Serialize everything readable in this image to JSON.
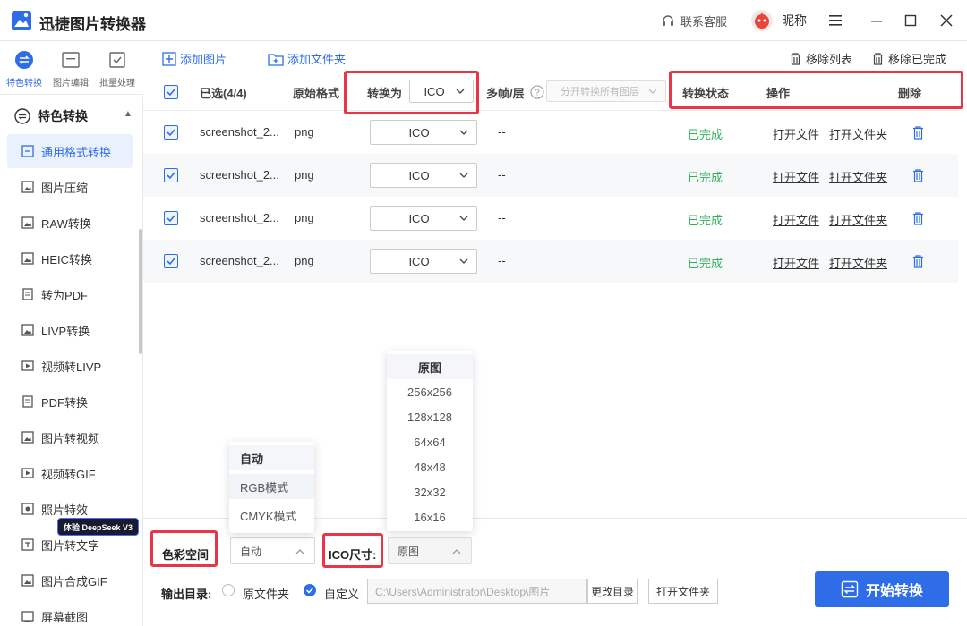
{
  "app": {
    "title": "迅捷图片转换器",
    "support_label": "联系客服",
    "nickname": "昵称"
  },
  "top_tabs": [
    {
      "label": "特色转换",
      "icon": "feature-convert-icon",
      "active": true
    },
    {
      "label": "图片编辑",
      "icon": "image-edit-icon",
      "active": false
    },
    {
      "label": "批量处理",
      "icon": "batch-process-icon",
      "active": false
    }
  ],
  "sidebar": {
    "section_title": "特色转换",
    "items": [
      {
        "label": "通用格式转换",
        "active": true
      },
      {
        "label": "图片压缩"
      },
      {
        "label": "RAW转换"
      },
      {
        "label": "HEIC转换"
      },
      {
        "label": "转为PDF"
      },
      {
        "label": "LIVP转换"
      },
      {
        "label": "视频转LIVP"
      },
      {
        "label": "PDF转换"
      },
      {
        "label": "图片转视频"
      },
      {
        "label": "视频转GIF"
      },
      {
        "label": "照片特效"
      },
      {
        "label": "图片转文字"
      },
      {
        "label": "图片合成GIF"
      },
      {
        "label": "屏幕截图"
      }
    ],
    "badge": "体验 DeepSeek V3"
  },
  "toolbar": {
    "add_image": "添加图片",
    "add_folder": "添加文件夹",
    "remove_list": "移除列表",
    "remove_done": "移除已完成"
  },
  "table": {
    "headers": {
      "selected": "已选(4/4)",
      "orig_format": "原始格式",
      "convert_to": "转换为",
      "convert_to_value": "ICO",
      "multi_frame": "多帧/层",
      "multi_frame_option": "分开转换所有图层",
      "status": "转换状态",
      "action": "操作",
      "delete": "删除"
    },
    "rows": [
      {
        "name": "screenshot_2...",
        "format": "png",
        "target": "ICO",
        "frames": "--",
        "status": "已完成",
        "open_file": "打开文件",
        "open_folder": "打开文件夹"
      },
      {
        "name": "screenshot_2...",
        "format": "png",
        "target": "ICO",
        "frames": "--",
        "status": "已完成",
        "open_file": "打开文件",
        "open_folder": "打开文件夹"
      },
      {
        "name": "screenshot_2...",
        "format": "png",
        "target": "ICO",
        "frames": "--",
        "status": "已完成",
        "open_file": "打开文件",
        "open_folder": "打开文件夹"
      },
      {
        "name": "screenshot_2...",
        "format": "png",
        "target": "ICO",
        "frames": "--",
        "status": "已完成",
        "open_file": "打开文件",
        "open_folder": "打开文件夹"
      }
    ]
  },
  "color_space": {
    "label": "色彩空间",
    "value": "自动",
    "options": [
      "自动",
      "RGB模式",
      "CMYK模式"
    ]
  },
  "ico_size": {
    "label": "ICO尺寸:",
    "value": "原图",
    "options": [
      "原图",
      "256x256",
      "128x128",
      "64x64",
      "48x48",
      "32x32",
      "16x16"
    ]
  },
  "output": {
    "label": "输出目录:",
    "option_original": "原文件夹",
    "option_custom": "自定义",
    "path": "C:\\Users\\Administrator\\Desktop\\图片",
    "change_dir": "更改目录",
    "open_folder": "打开文件夹"
  },
  "start_button": "开始转换",
  "colors": {
    "accent": "#2f6de8",
    "done": "#2fb25a",
    "highlight": "#ea3449"
  }
}
